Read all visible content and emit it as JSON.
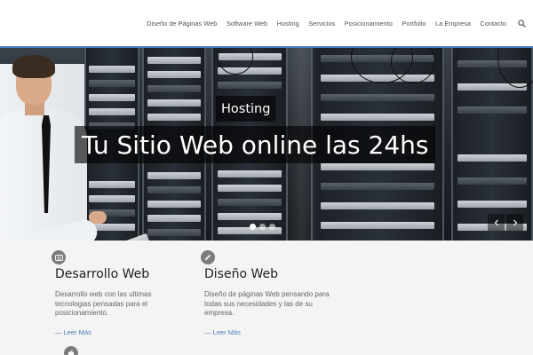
{
  "header": {
    "nav": [
      {
        "label": "Diseño de Páginas Web"
      },
      {
        "label": "Software Web"
      },
      {
        "label": "Hosting"
      },
      {
        "label": "Servicios"
      },
      {
        "label": "Posicionamiento"
      },
      {
        "label": "Portfolio"
      },
      {
        "label": "La Empresa"
      },
      {
        "label": "Contacto"
      }
    ],
    "search_icon": "search-icon"
  },
  "hero": {
    "tag": "Hosting",
    "title": "Tu Sitio Web online las 24hs",
    "slide_count": 3,
    "active_slide": 1,
    "prev_icon": "chevron-left-icon",
    "next_icon": "chevron-right-icon"
  },
  "services": [
    {
      "icon": "keyboard-icon",
      "title": "Desarrollo Web",
      "text_lines": [
        "Desarrollo web con las ultimas",
        "tecnologias pensadas para el",
        "posicionamiento."
      ],
      "more": "— Leer Más"
    },
    {
      "icon": "pencil-icon",
      "title": "Diseño Web",
      "text_lines": [
        "Diseño de páginas Web pensando para",
        "todas sus necesidades y las de su",
        "empresa."
      ],
      "more": "— Leer Más"
    },
    {
      "icon": "apple-icon"
    }
  ],
  "colors": {
    "accent": "#4a7ebb",
    "icon_circle": "#7c7c7c",
    "services_bg": "#f4f4f4",
    "caption_bg": "rgba(0,0,0,0.62)"
  }
}
